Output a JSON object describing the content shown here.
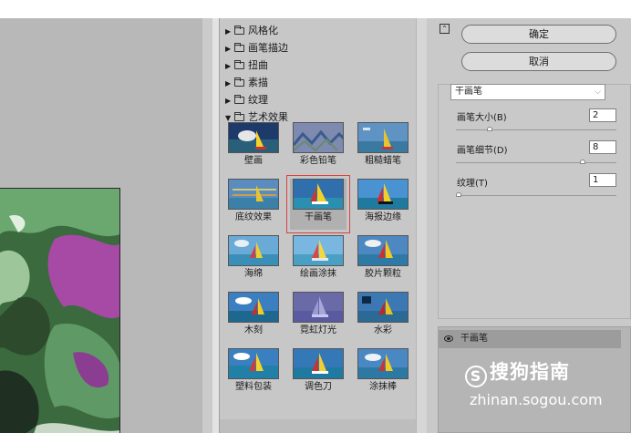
{
  "gallery": {
    "categories": [
      {
        "label": "风格化",
        "expanded": false
      },
      {
        "label": "画笔描边",
        "expanded": false
      },
      {
        "label": "扭曲",
        "expanded": false
      },
      {
        "label": "素描",
        "expanded": false
      },
      {
        "label": "纹理",
        "expanded": false
      },
      {
        "label": "艺术效果",
        "expanded": true
      }
    ],
    "filters": [
      {
        "label": "壁画"
      },
      {
        "label": "彩色铅笔"
      },
      {
        "label": "粗糙蜡笔"
      },
      {
        "label": "底纹效果"
      },
      {
        "label": "干画笔",
        "selected": true
      },
      {
        "label": "海报边缘"
      },
      {
        "label": "海绵"
      },
      {
        "label": "绘画涂抹"
      },
      {
        "label": "胶片颗粒"
      },
      {
        "label": "木刻"
      },
      {
        "label": "霓虹灯光"
      },
      {
        "label": "水彩"
      },
      {
        "label": "塑料包装"
      },
      {
        "label": "调色刀"
      },
      {
        "label": "涂抹棒"
      }
    ]
  },
  "buttons": {
    "ok": "确定",
    "cancel": "取消"
  },
  "filter_select": {
    "value": "干画笔"
  },
  "params": [
    {
      "label": "画笔大小(B)",
      "value": "2",
      "fraction": 0.2
    },
    {
      "label": "画笔细节(D)",
      "value": "8",
      "fraction": 0.8
    },
    {
      "label": "纹理(T)",
      "value": "1",
      "fraction": 0.0
    }
  ],
  "layers": [
    {
      "label": "干画笔",
      "visible": true
    }
  ],
  "watermark": {
    "logo": "搜狗指南",
    "url": "zhinan.sogou.com"
  },
  "icons": {
    "collapse": "collapse-up-icon",
    "eye": "eye-icon",
    "folder": "folder-icon"
  },
  "colors": {
    "selection_outline": "#d84040",
    "panel": "#c9c9c9"
  }
}
